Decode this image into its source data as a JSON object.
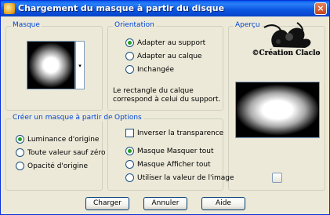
{
  "window": {
    "title": "Chargement du masque à partir du disque",
    "close_label": "×"
  },
  "masque": {
    "legend": "Masque",
    "dropdown_arrow": "▾"
  },
  "orientation": {
    "legend": "Orientation",
    "options": [
      "Adapter au support",
      "Adapter au calque",
      "Inchangée"
    ],
    "selected": "Adapter au support",
    "note": "Le rectangle du calque correspond à celui du support."
  },
  "apercu": {
    "legend": "Aperçu",
    "watermark": "©Création Claclo"
  },
  "creer": {
    "legend": "Créer un masque à partir de :",
    "options": [
      "Luminance d'origine",
      "Toute valeur sauf zéro",
      "Opacité d'origine"
    ],
    "selected": "Luminance d'origine"
  },
  "options": {
    "legend": "Options",
    "invert_label": "Inverser la transparence",
    "invert_checked": false,
    "radios": [
      "Masque Masquer tout",
      "Masque Afficher tout",
      "Utiliser la valeur de l'image"
    ],
    "selected": "Masque Masquer tout"
  },
  "buttons": {
    "load": "Charger",
    "cancel": "Annuler",
    "help": "Aide"
  }
}
